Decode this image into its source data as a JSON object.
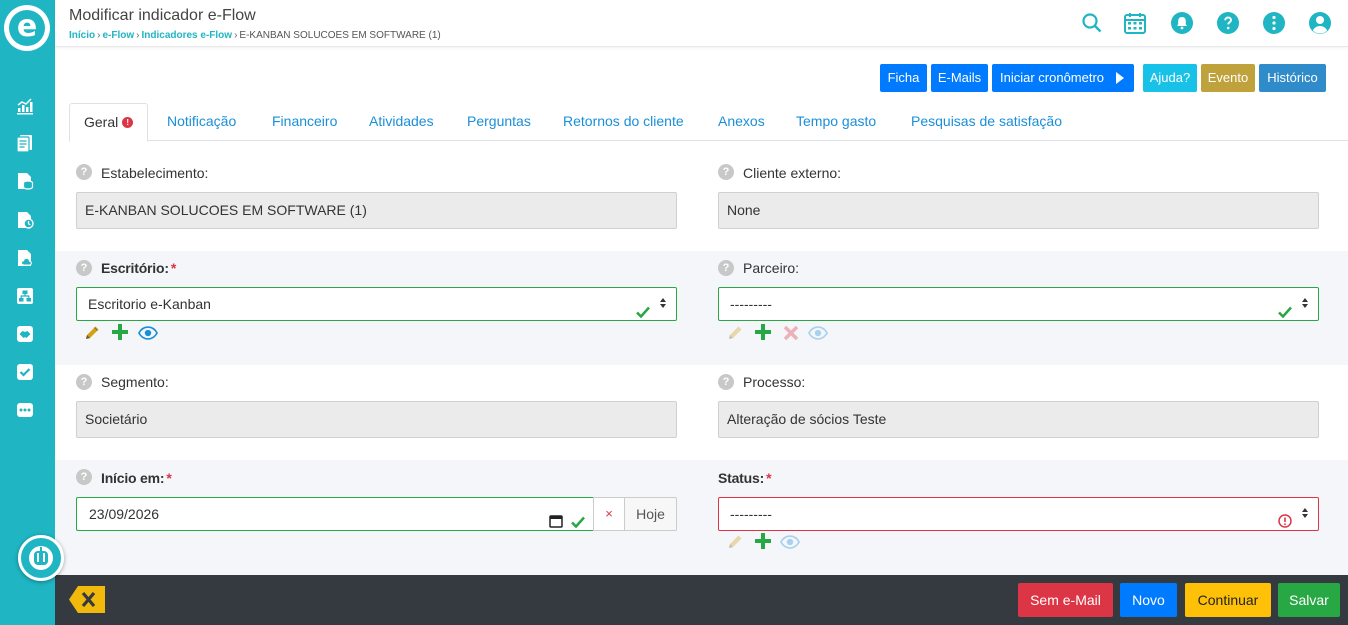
{
  "app": {
    "logo_letter": "e"
  },
  "sidebar": {
    "items": [
      {
        "icon": "chart-icon"
      },
      {
        "icon": "documents-icon"
      },
      {
        "icon": "database-docs-icon"
      },
      {
        "icon": "time-docs-icon"
      },
      {
        "icon": "cloud-docs-icon"
      },
      {
        "icon": "org-chart-icon"
      },
      {
        "icon": "handshake-icon"
      },
      {
        "icon": "task-check-icon"
      },
      {
        "icon": "more-icon"
      }
    ]
  },
  "header": {
    "title": "Modificar indicador e-Flow",
    "breadcrumb": [
      "Início",
      "e-Flow",
      "Indicadores e-Flow",
      "E-KANBAN SOLUCOES EM SOFTWARE (1)"
    ],
    "breadcrumb_sep": "›"
  },
  "actions": {
    "ficha": "Ficha",
    "emails": "E-Mails",
    "cronometro": "Iniciar cronômetro",
    "ajuda": "Ajuda?",
    "evento": "Evento",
    "historico": "Histórico"
  },
  "tabs": [
    {
      "label": "Geral",
      "badge": "!"
    },
    {
      "label": "Notificação"
    },
    {
      "label": "Financeiro"
    },
    {
      "label": "Atividades"
    },
    {
      "label": "Perguntas"
    },
    {
      "label": "Retornos do cliente"
    },
    {
      "label": "Anexos"
    },
    {
      "label": "Tempo gasto"
    },
    {
      "label": "Pesquisas de satisfação"
    }
  ],
  "form": {
    "help_glyph": "?",
    "required_mark": "*",
    "estabelecimento": {
      "label": "Estabelecimento:",
      "value": "E-KANBAN SOLUCOES EM SOFTWARE (1)"
    },
    "cliente_externo": {
      "label": "Cliente externo:",
      "value": "None"
    },
    "escritorio": {
      "label": "Escritório:",
      "value": "Escritorio e-Kanban"
    },
    "parceiro": {
      "label": "Parceiro:",
      "value": "---------"
    },
    "segmento": {
      "label": "Segmento:",
      "value": "Societário"
    },
    "processo": {
      "label": "Processo:",
      "value": "Alteração de sócios Teste"
    },
    "inicio": {
      "label": "Início em:",
      "value": "23/09/2026",
      "clear": "×",
      "today": "Hoje"
    },
    "status": {
      "label": "Status:",
      "value": "---------"
    }
  },
  "footer": {
    "sem_email": "Sem e-Mail",
    "novo": "Novo",
    "continuar": "Continuar",
    "salvar": "Salvar"
  },
  "colors": {
    "brand": "#1fb5c3",
    "primary": "#007bff",
    "success": "#28a745",
    "danger": "#dc3545",
    "warning": "#ffc107",
    "info": "#17a2b8",
    "evento": "#c0a23c",
    "historico": "#2f8bc9",
    "footer": "#343a40"
  }
}
